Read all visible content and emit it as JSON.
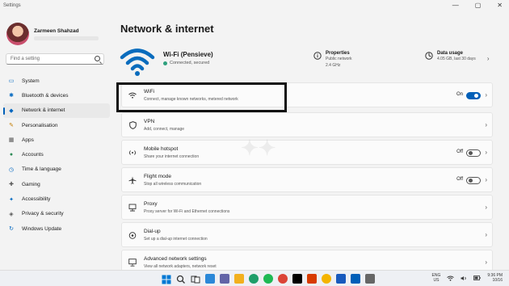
{
  "window": {
    "title": "Settings",
    "controls": [
      "—",
      "▢",
      "✕"
    ]
  },
  "profile": {
    "name": "Zarmeen Shahzad"
  },
  "search": {
    "placeholder": "Find a setting"
  },
  "nav": [
    {
      "label": "System",
      "icon": "monitor-icon",
      "color": "#0067c0"
    },
    {
      "label": "Bluetooth & devices",
      "icon": "bluetooth-icon",
      "color": "#0067c0"
    },
    {
      "label": "Network & internet",
      "icon": "network-icon",
      "color": "#0067c0",
      "active": true
    },
    {
      "label": "Personalisation",
      "icon": "brush-icon",
      "color": "#c27b00"
    },
    {
      "label": "Apps",
      "icon": "apps-icon",
      "color": "#555555"
    },
    {
      "label": "Accounts",
      "icon": "person-icon",
      "color": "#2e8b57"
    },
    {
      "label": "Time & language",
      "icon": "globe-clock-icon",
      "color": "#0067c0"
    },
    {
      "label": "Gaming",
      "icon": "gamepad-icon",
      "color": "#555555"
    },
    {
      "label": "Accessibility",
      "icon": "accessibility-icon",
      "color": "#0067c0"
    },
    {
      "label": "Privacy & security",
      "icon": "shield-icon",
      "color": "#555555"
    },
    {
      "label": "Windows Update",
      "icon": "update-icon",
      "color": "#0067c0"
    }
  ],
  "main": {
    "title": "Network & internet",
    "connection": {
      "name": "Wi-Fi (Pensieve)",
      "status": "Connected, secured"
    },
    "properties": {
      "title": "Properties",
      "line1": "Public network",
      "line2": "2.4 GHz"
    },
    "data_usage": {
      "title": "Data usage",
      "line1": "4.05 GB, last 30 days"
    }
  },
  "rows": [
    {
      "title": "WiFi",
      "subtitle": "Connect, manage known networks, metered network",
      "icon": "wifi-icon",
      "toggle": "On",
      "toggle_on": true
    },
    {
      "title": "VPN",
      "subtitle": "Add, connect, manage",
      "icon": "vpn-shield-icon"
    },
    {
      "title": "Mobile hotspot",
      "subtitle": "Share your internet connection",
      "icon": "hotspot-icon",
      "toggle": "Off",
      "toggle_on": false
    },
    {
      "title": "Flight mode",
      "subtitle": "Stop all wireless communication",
      "icon": "airplane-icon",
      "toggle": "Off",
      "toggle_on": false
    },
    {
      "title": "Proxy",
      "subtitle": "Proxy server for Wi-Fi and Ethernet connections",
      "icon": "proxy-icon"
    },
    {
      "title": "Dial-up",
      "subtitle": "Set up a dial-up internet connection",
      "icon": "dialup-icon"
    },
    {
      "title": "Advanced network settings",
      "subtitle": "View all network adapters, network reset",
      "icon": "monitor-network-icon"
    }
  ],
  "taskbar": {
    "lang1": "ENG",
    "lang2": "US",
    "time": "9:36 PM",
    "date": "10/16",
    "apps": [
      {
        "icon": "windows-start-icon",
        "color": "#0078d4"
      },
      {
        "icon": "search-icon",
        "color": "#333333"
      },
      {
        "icon": "task-view-icon",
        "color": "#333333"
      },
      {
        "icon": "widgets-icon",
        "color": "#2b88d8"
      },
      {
        "icon": "chat-icon",
        "color": "#6264a7"
      },
      {
        "icon": "file-explorer-icon",
        "color": "#f2b01e"
      },
      {
        "icon": "edge-icon",
        "color": "#1e9e6a"
      },
      {
        "icon": "spotify-icon",
        "color": "#1db954"
      },
      {
        "icon": "chrome-icon",
        "color": "#db4437"
      },
      {
        "icon": "netflix-icon",
        "color": "#000000"
      },
      {
        "icon": "photos-icon",
        "color": "#d83b01"
      },
      {
        "icon": "chrome-alt-icon",
        "color": "#f4b400"
      },
      {
        "icon": "word-icon",
        "color": "#185abd"
      },
      {
        "icon": "store-icon",
        "color": "#005fb8"
      },
      {
        "icon": "settings-gear-icon",
        "color": "#666666"
      }
    ]
  }
}
